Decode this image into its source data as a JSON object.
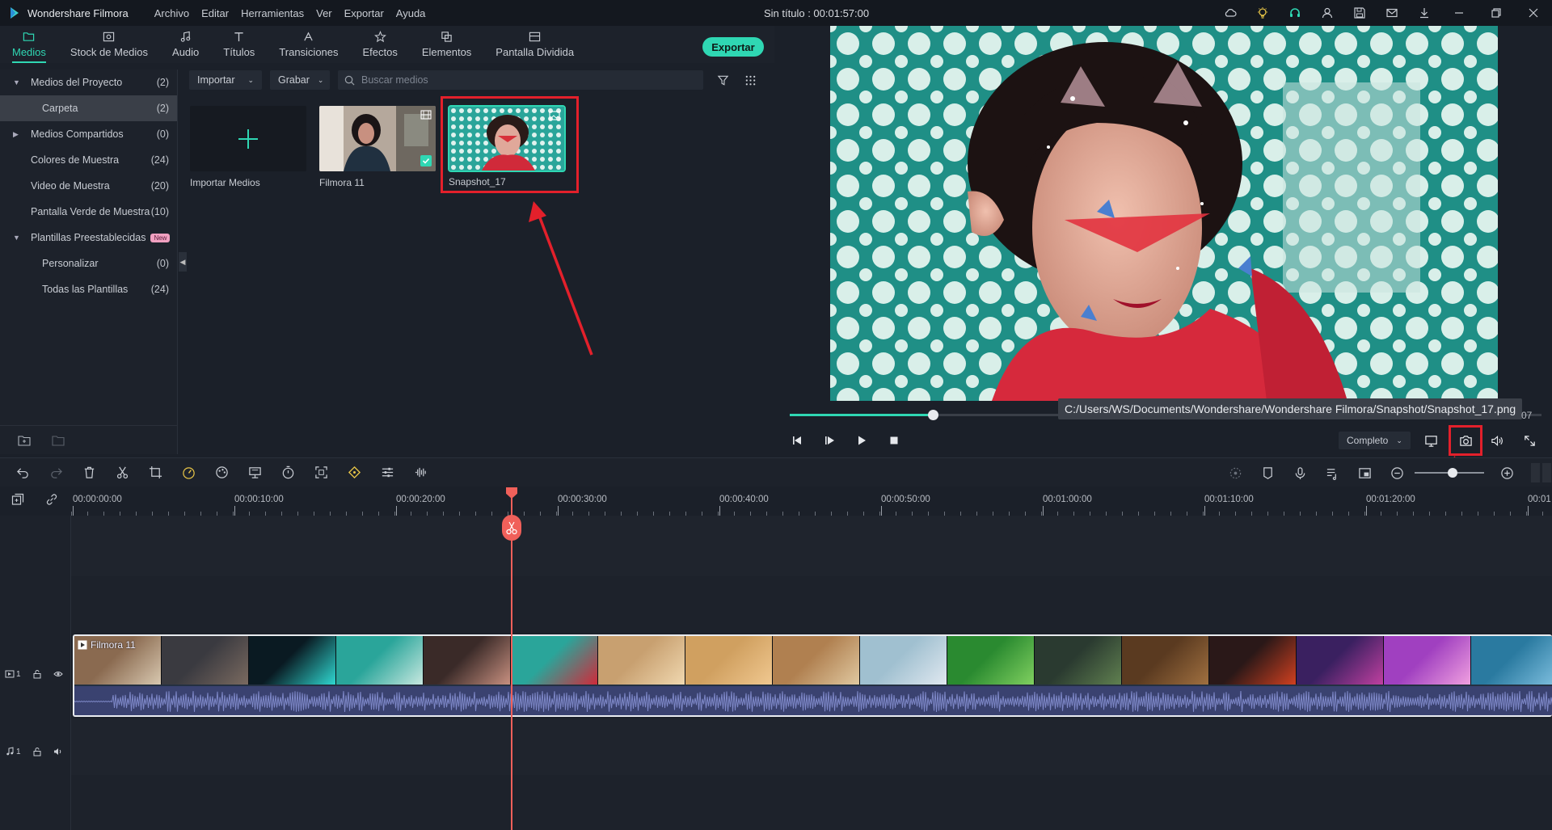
{
  "app": {
    "name": "Wondershare Filmora",
    "title": "Sin título : 00:01:57:00",
    "menu": [
      "Archivo",
      "Editar",
      "Herramientas",
      "Ver",
      "Exportar",
      "Ayuda"
    ],
    "window_icons": [
      "cloud-icon",
      "lightbulb-icon",
      "headset-icon",
      "user-icon",
      "save-icon",
      "mail-icon",
      "download-icon",
      "minimize-icon",
      "restore-icon",
      "close-icon"
    ]
  },
  "tabs": [
    {
      "label": "Medios",
      "icon": "folder-icon",
      "active": true
    },
    {
      "label": "Stock de Medios",
      "icon": "image-icon"
    },
    {
      "label": "Audio",
      "icon": "music-icon"
    },
    {
      "label": "Títulos",
      "icon": "text-icon"
    },
    {
      "label": "Transiciones",
      "icon": "transition-icon"
    },
    {
      "label": "Efectos",
      "icon": "effects-icon"
    },
    {
      "label": "Elementos",
      "icon": "elements-icon"
    },
    {
      "label": "Pantalla Dividida",
      "icon": "split-screen-icon"
    }
  ],
  "export_label": "Exportar",
  "sidebar": {
    "items": [
      {
        "label": "Medios del Proyecto",
        "count": "(2)",
        "arrow": "▼",
        "indent": 0
      },
      {
        "label": "Carpeta",
        "count": "(2)",
        "arrow": "",
        "indent": 1,
        "selected": true
      },
      {
        "label": "Medios Compartidos",
        "count": "(0)",
        "arrow": "▶",
        "indent": 0
      },
      {
        "label": "Colores de Muestra",
        "count": "(24)",
        "arrow": "",
        "indent": 0
      },
      {
        "label": "Video de Muestra",
        "count": "(20)",
        "arrow": "",
        "indent": 0
      },
      {
        "label": "Pantalla Verde de Muestra",
        "count": "(10)",
        "arrow": "",
        "indent": 0
      },
      {
        "label": "Plantillas Preestablecidas",
        "count": "",
        "arrow": "▼",
        "indent": 0,
        "badge": "New"
      },
      {
        "label": "Personalizar",
        "count": "(0)",
        "arrow": "",
        "indent": 1
      },
      {
        "label": "Todas las Plantillas",
        "count": "(24)",
        "arrow": "",
        "indent": 1
      }
    ]
  },
  "media_toolbar": {
    "import_label": "Importar",
    "record_label": "Grabar",
    "search_placeholder": "Buscar medios"
  },
  "media_items": [
    {
      "name": "Importar Medios",
      "type": "import"
    },
    {
      "name": "Filmora 11",
      "type": "video",
      "checked": true
    },
    {
      "name": "Snapshot_17",
      "type": "image",
      "highlighted": true
    }
  ],
  "preview": {
    "snapshot_path": "C:/Users/WS/Documents/Wondershare/Wondershare Filmora/Snapshot/Snapshot_17.png",
    "time_tail": "07",
    "progress": 0.19,
    "quality": "Completo"
  },
  "timeline": {
    "ruler_labels": [
      "00:00:00:00",
      "00:00:10:00",
      "00:00:20:00",
      "00:00:30:00",
      "00:00:40:00",
      "00:00:50:00",
      "00:01:00:00",
      "00:01:10:00",
      "00:01:20:00",
      "00:01"
    ],
    "video_track_label": "1",
    "audio_track_label": "1",
    "clip_name": "Filmora 11",
    "zoom_level": 0.55
  },
  "colors": {
    "accent": "#2fd7b3",
    "highlight_red": "#e3202b",
    "playhead": "#f0605a"
  }
}
